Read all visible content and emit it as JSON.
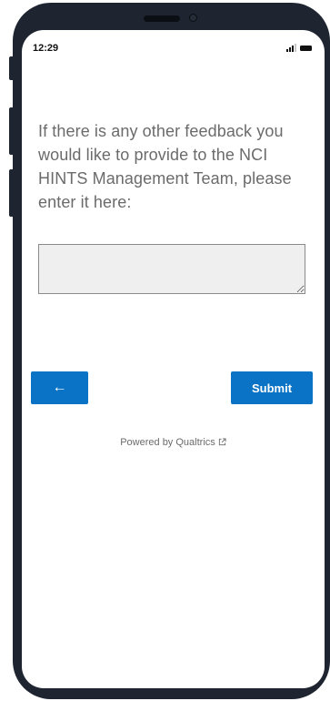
{
  "status_bar": {
    "time": "12:29",
    "signal_icon": "signal-bars-icon",
    "battery_icon": "battery-icon"
  },
  "survey": {
    "question_text": "If there is any other feedback you would like to provide to the NCI HINTS Management Team, please enter it here:",
    "answer_value": ""
  },
  "navigation": {
    "back_label": "←",
    "submit_label": "Submit"
  },
  "footer": {
    "powered_by": "Powered by Qualtrics",
    "external_icon": "external-link-icon"
  },
  "colors": {
    "button_blue": "#0a73c5",
    "question_text": "#6b6b6b",
    "phone_frame": "#1f2530"
  }
}
